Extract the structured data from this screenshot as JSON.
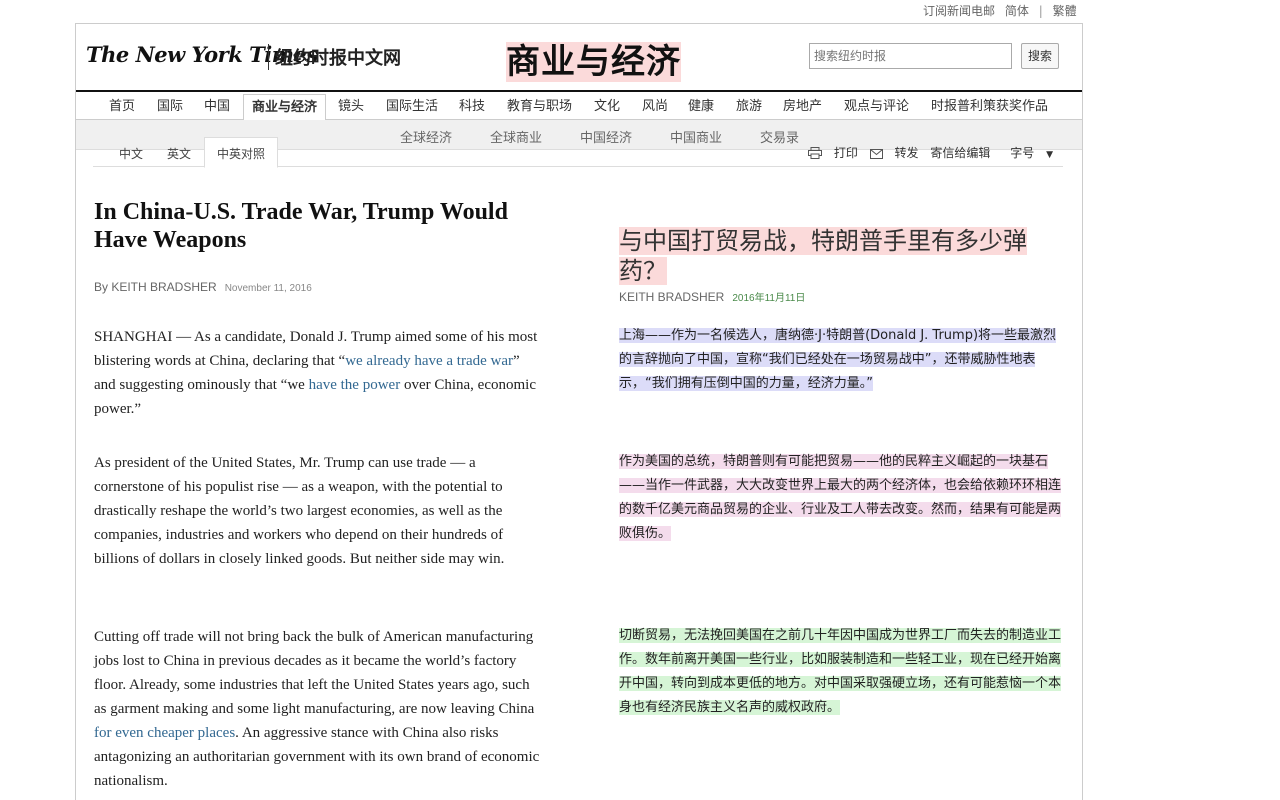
{
  "toplinks": {
    "subscribe": "订阅新闻电邮",
    "simplified": "简体",
    "sep": "|",
    "traditional": "繁體"
  },
  "masthead": {
    "logo_en": "The New York Times",
    "logo_cn": "纽约时报中文网",
    "section": "商业与经济",
    "search_placeholder": "搜索纽约时报",
    "search_button": "搜索"
  },
  "nav": {
    "items": [
      "首页",
      "国际",
      "中国",
      "商业与经济",
      "镜头",
      "国际生活",
      "科技",
      "教育与职场",
      "文化",
      "风尚",
      "健康",
      "旅游",
      "房地产",
      "观点与评论",
      "时报普利策获奖作品"
    ],
    "active_index": 3
  },
  "subnav": {
    "items": [
      "全球经济",
      "全球商业",
      "中国经济",
      "中国商业",
      "交易录"
    ]
  },
  "tabs": {
    "chinese": "中文",
    "english": "英文",
    "bilingual": "中英对照"
  },
  "tools": {
    "print": "打印",
    "forward": "转发",
    "letter": "寄信给编辑",
    "font": "字号"
  },
  "article_en": {
    "title": "In China-U.S. Trade War, Trump Would Have Weapons",
    "by": "By KEITH BRADSHER",
    "date": "November 11, 2016",
    "p1_a": "SHANGHAI — As a candidate, Donald J. Trump aimed some of his most blistering words at China, declaring that “",
    "p1_link1": "we already have a trade war",
    "p1_b": "” and suggesting ominously that “we ",
    "p1_link2": "have the power",
    "p1_c": " over China, economic power.”",
    "p2": "As president of the United States, Mr. Trump can use trade — a cornerstone of his populist rise — as a weapon, with the potential to drastically reshape the world’s two largest economies, as well as the companies, industries and workers who depend on their hundreds of billions of dollars in closely linked goods. But neither side may win.",
    "p3_a": "Cutting off trade will not bring back the bulk of American manufacturing jobs lost to China in previous decades as it became the world’s factory floor. Already, some industries that left the United States years ago, such as garment making and some light manufacturing, are now leaving China ",
    "p3_link": "for even cheaper places",
    "p3_b": ". An aggressive stance with China also risks antagonizing an authoritarian government with its own brand of economic nationalism."
  },
  "article_cn": {
    "title": "与中国打贸易战，特朗普手里有多少弹药？",
    "by": "KEITH BRADSHER",
    "date": "2016年11月11日",
    "p1": "上海——作为一名候选人，唐纳德·J·特朗普(Donald J. Trump)将一些最激烈的言辞抛向了中国，宣称“我们已经处在一场贸易战中”，还带威胁性地表示，“我们拥有压倒中国的力量，经济力量。”",
    "p2": "作为美国的总统，特朗普则有可能把贸易——他的民粹主义崛起的一块基石——当作一件武器，大大改变世界上最大的两个经济体，也会给依赖环环相连的数千亿美元商品贸易的企业、行业及工人带去改变。然而，结果有可能是两败俱伤。",
    "p3": "切断贸易，无法挽回美国在之前几十年因中国成为世界工厂而失去的制造业工作。数年前离开美国一些行业，比如服装制造和一些轻工业，现在已经开始离开中国，转向到成本更低的地方。对中国采取强硬立场，还有可能惹恼一个本身也有经济民族主义名声的威权政府。"
  }
}
